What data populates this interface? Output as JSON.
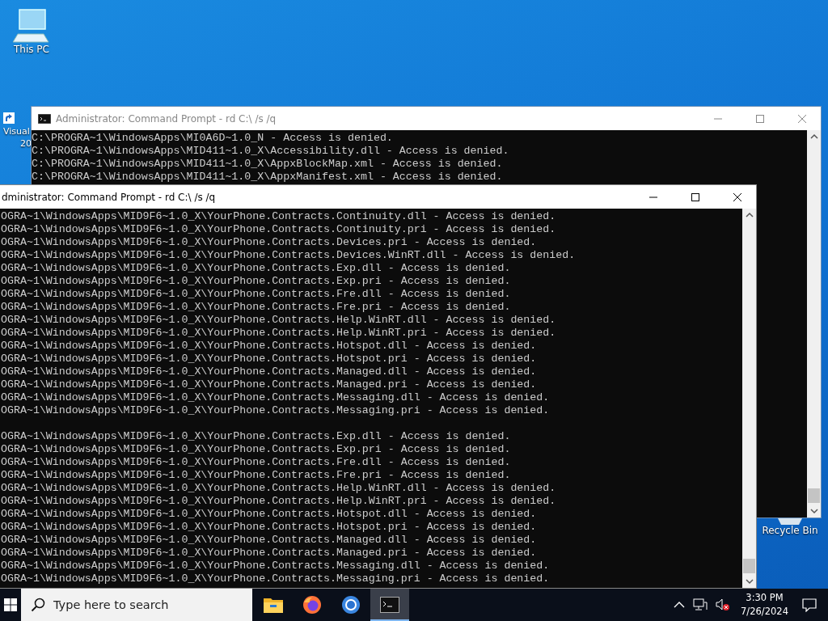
{
  "desktop_icons": [
    {
      "kind": "pc",
      "label_lines": [
        "This PC"
      ]
    },
    {
      "kind": "shortcut",
      "label_lines": [
        "Visual",
        "20"
      ]
    },
    {
      "kind": "recycle",
      "label_lines": [
        "Recycle Bin"
      ]
    }
  ],
  "windows": [
    {
      "title": "Administrator: Command Prompt - rd  C:\\ /s /q",
      "active": false,
      "output_blocks": [
        [
          "C:\\PROGRA~1\\WindowsApps\\MI0A6D~1.0_N - Access is denied.",
          "C:\\PROGRA~1\\WindowsApps\\MID411~1.0_X\\Accessibility.dll - Access is denied.",
          "C:\\PROGRA~1\\WindowsApps\\MID411~1.0_X\\AppxBlockMap.xml - Access is denied.",
          "C:\\PROGRA~1\\WindowsApps\\MID411~1.0_X\\AppxManifest.xml - Access is denied."
        ]
      ]
    },
    {
      "title": "dministrator: Command Prompt - rd  C:\\ /s /q",
      "active": true,
      "output_blocks": [
        [
          "OGRA~1\\WindowsApps\\MID9F6~1.0_X\\YourPhone.Contracts.Continuity.dll - Access is denied.",
          "OGRA~1\\WindowsApps\\MID9F6~1.0_X\\YourPhone.Contracts.Continuity.pri - Access is denied.",
          "OGRA~1\\WindowsApps\\MID9F6~1.0_X\\YourPhone.Contracts.Devices.pri - Access is denied.",
          "OGRA~1\\WindowsApps\\MID9F6~1.0_X\\YourPhone.Contracts.Devices.WinRT.dll - Access is denied.",
          "OGRA~1\\WindowsApps\\MID9F6~1.0_X\\YourPhone.Contracts.Exp.dll - Access is denied.",
          "OGRA~1\\WindowsApps\\MID9F6~1.0_X\\YourPhone.Contracts.Exp.pri - Access is denied.",
          "OGRA~1\\WindowsApps\\MID9F6~1.0_X\\YourPhone.Contracts.Fre.dll - Access is denied.",
          "OGRA~1\\WindowsApps\\MID9F6~1.0_X\\YourPhone.Contracts.Fre.pri - Access is denied.",
          "OGRA~1\\WindowsApps\\MID9F6~1.0_X\\YourPhone.Contracts.Help.WinRT.dll - Access is denied.",
          "OGRA~1\\WindowsApps\\MID9F6~1.0_X\\YourPhone.Contracts.Help.WinRT.pri - Access is denied.",
          "OGRA~1\\WindowsApps\\MID9F6~1.0_X\\YourPhone.Contracts.Hotspot.dll - Access is denied.",
          "OGRA~1\\WindowsApps\\MID9F6~1.0_X\\YourPhone.Contracts.Hotspot.pri - Access is denied.",
          "OGRA~1\\WindowsApps\\MID9F6~1.0_X\\YourPhone.Contracts.Managed.dll - Access is denied.",
          "OGRA~1\\WindowsApps\\MID9F6~1.0_X\\YourPhone.Contracts.Managed.pri - Access is denied.",
          "OGRA~1\\WindowsApps\\MID9F6~1.0_X\\YourPhone.Contracts.Messaging.dll - Access is denied.",
          "OGRA~1\\WindowsApps\\MID9F6~1.0_X\\YourPhone.Contracts.Messaging.pri - Access is denied."
        ],
        [
          "OGRA~1\\WindowsApps\\MID9F6~1.0_X\\YourPhone.Contracts.Exp.dll - Access is denied.",
          "OGRA~1\\WindowsApps\\MID9F6~1.0_X\\YourPhone.Contracts.Exp.pri - Access is denied.",
          "OGRA~1\\WindowsApps\\MID9F6~1.0_X\\YourPhone.Contracts.Fre.dll - Access is denied.",
          "OGRA~1\\WindowsApps\\MID9F6~1.0_X\\YourPhone.Contracts.Fre.pri - Access is denied.",
          "OGRA~1\\WindowsApps\\MID9F6~1.0_X\\YourPhone.Contracts.Help.WinRT.dll - Access is denied.",
          "OGRA~1\\WindowsApps\\MID9F6~1.0_X\\YourPhone.Contracts.Help.WinRT.pri - Access is denied.",
          "OGRA~1\\WindowsApps\\MID9F6~1.0_X\\YourPhone.Contracts.Hotspot.dll - Access is denied.",
          "OGRA~1\\WindowsApps\\MID9F6~1.0_X\\YourPhone.Contracts.Hotspot.pri - Access is denied.",
          "OGRA~1\\WindowsApps\\MID9F6~1.0_X\\YourPhone.Contracts.Managed.dll - Access is denied.",
          "OGRA~1\\WindowsApps\\MID9F6~1.0_X\\YourPhone.Contracts.Managed.pri - Access is denied.",
          "OGRA~1\\WindowsApps\\MID9F6~1.0_X\\YourPhone.Contracts.Messaging.dll - Access is denied.",
          "OGRA~1\\WindowsApps\\MID9F6~1.0_X\\YourPhone.Contracts.Messaging.pri - Access is denied."
        ]
      ]
    }
  ],
  "taskbar": {
    "search": {
      "placeholder": "Type here to search"
    },
    "apps": [
      {
        "kind": "folder",
        "selected": false
      },
      {
        "kind": "firefox",
        "selected": false
      },
      {
        "kind": "chrome",
        "selected": false
      },
      {
        "kind": "terminal",
        "selected": true
      }
    ],
    "clock": {
      "time": "3:30 PM",
      "date": "7/26/2024"
    }
  }
}
